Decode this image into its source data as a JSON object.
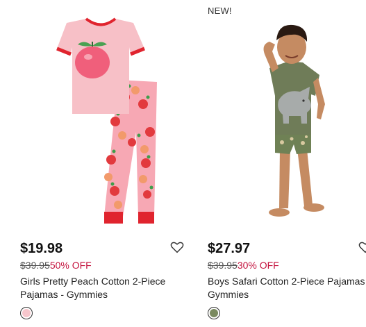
{
  "products": [
    {
      "price": "$19.98",
      "original_price": "$39.95",
      "discount": "50% OFF",
      "name": "Girls Pretty Peach Cotton 2-Piece Pajamas - Gymmies",
      "swatch_color": "#f7c6cc",
      "wishlist_icon": "heart-outline-icon"
    },
    {
      "badge": "NEW!",
      "price": "$27.97",
      "original_price": "$39.95",
      "discount": "30% OFF",
      "name": "Boys Safari Cotton 2-Piece Pajamas - Gymmies",
      "swatch_color": "#7a8a5f",
      "wishlist_icon": "heart-outline-icon"
    }
  ],
  "colors": {
    "sale_red": "#c4123d",
    "price": "#111111"
  }
}
